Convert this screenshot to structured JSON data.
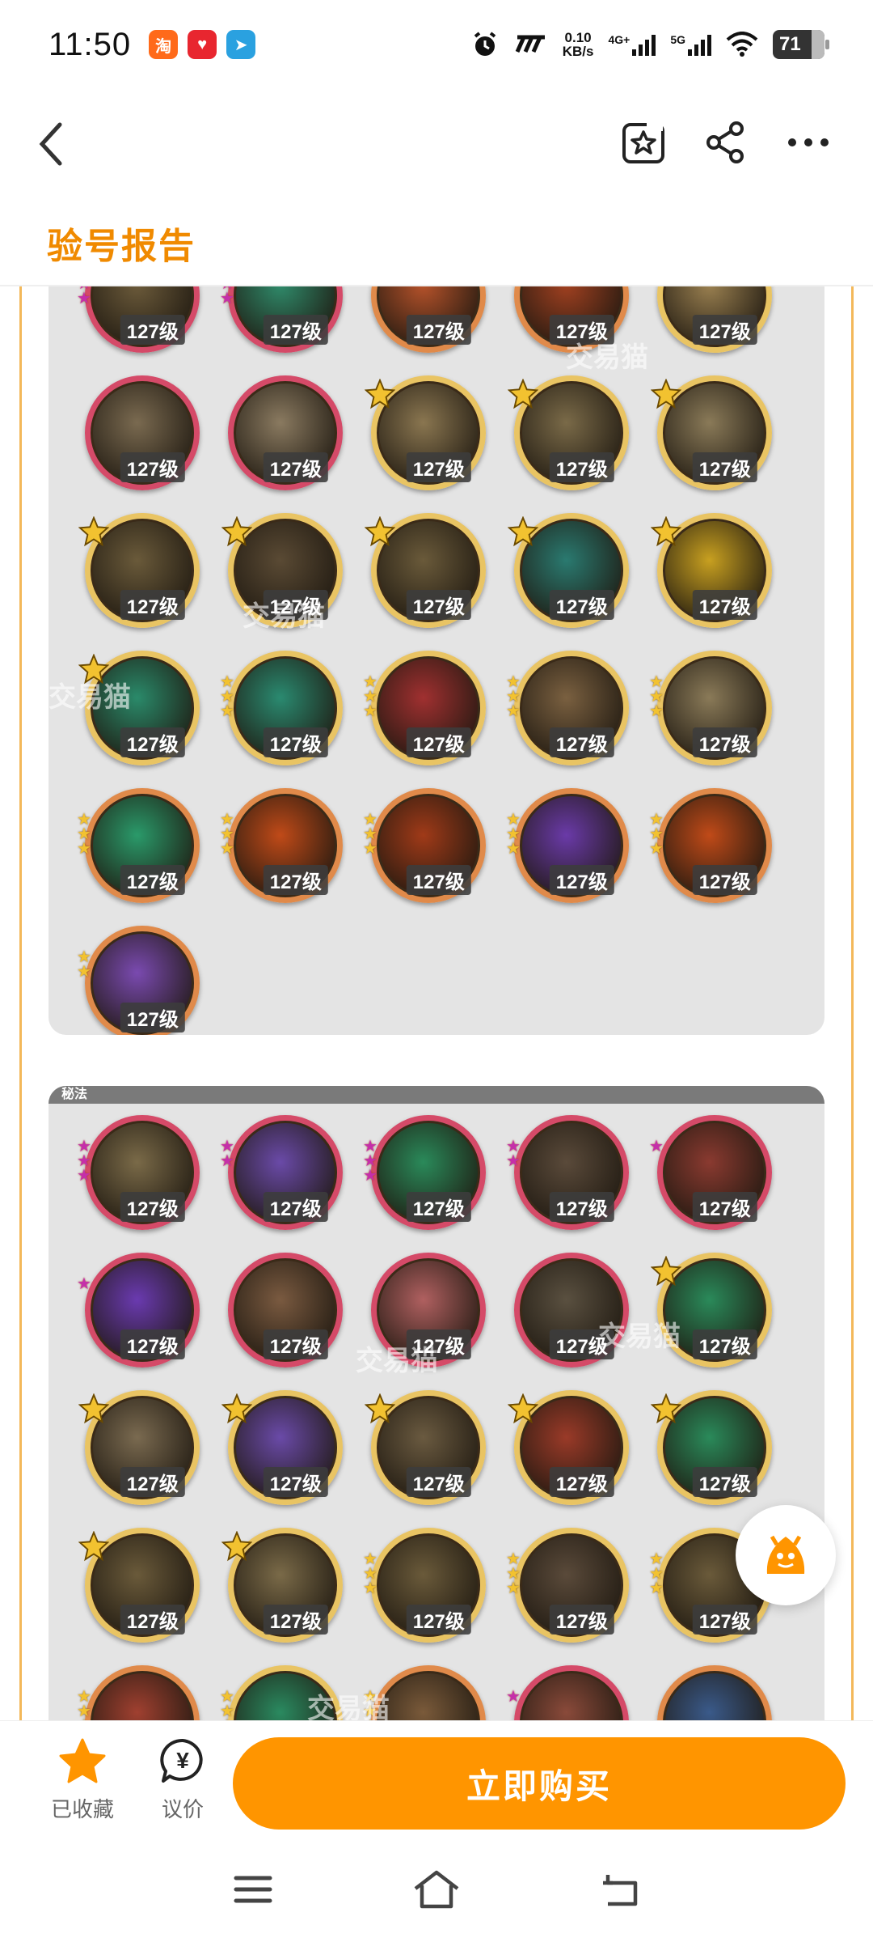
{
  "status_bar": {
    "time": "11:50",
    "net_speed_value": "0.10",
    "net_speed_unit": "KB/s",
    "signal1": "4G+",
    "signal2": "5G",
    "battery": "71",
    "apps": [
      {
        "name": "taobao-app-icon",
        "glyph": "淘",
        "color": "#ff6a1a"
      },
      {
        "name": "red-app-icon",
        "glyph": "♥",
        "color": "#e8262f"
      },
      {
        "name": "telegram-app-icon",
        "glyph": "➤",
        "color": "#2aa1e0"
      }
    ]
  },
  "header": {
    "title": "验号报告"
  },
  "panels": {
    "secret_label": "秘法"
  },
  "skill_level": "127级",
  "watermark": "交易猫",
  "bottom_bar": {
    "favorite_label": "已收藏",
    "bargain_label": "议价",
    "bargain_glyph": "¥",
    "buy_label": "立即购买"
  },
  "colors": {
    "accent": "#ff9500",
    "title": "#f08a00",
    "frame": "#f3b85a"
  },
  "skills_panel1": [
    {
      "ring": "red",
      "badge": "stars3",
      "art": "#6b5a3a"
    },
    {
      "ring": "red",
      "badge": "stars3",
      "art": "#2f8a6a"
    },
    {
      "ring": "orange",
      "badge": "none",
      "art": "#b5522a"
    },
    {
      "ring": "orange",
      "badge": "stars1",
      "art": "#a04020"
    },
    {
      "ring": "gold",
      "badge": "none",
      "art": "#9a8050"
    },
    {
      "ring": "red",
      "badge": "none",
      "art": "#7a6a50"
    },
    {
      "ring": "red",
      "badge": "none",
      "art": "#8a7a60"
    },
    {
      "ring": "gold",
      "badge": "five",
      "art": "#8a7650"
    },
    {
      "ring": "gold",
      "badge": "five",
      "art": "#7a6a48"
    },
    {
      "ring": "gold",
      "badge": "five",
      "art": "#8a7a58"
    },
    {
      "ring": "gold",
      "badge": "five",
      "art": "#6a5a3a"
    },
    {
      "ring": "gold",
      "badge": "five",
      "art": "#5a4a34"
    },
    {
      "ring": "gold",
      "badge": "five",
      "art": "#6a5a3a"
    },
    {
      "ring": "gold",
      "badge": "five",
      "art": "#2a7a70"
    },
    {
      "ring": "gold",
      "badge": "five",
      "art": "#c8a020"
    },
    {
      "ring": "gold",
      "badge": "five",
      "art": "#2a8a6a"
    },
    {
      "ring": "gold",
      "badge": "stars3",
      "art": "#2a8a70"
    },
    {
      "ring": "gold",
      "badge": "stars3",
      "art": "#a03030"
    },
    {
      "ring": "gold",
      "badge": "stars3",
      "art": "#7a6040"
    },
    {
      "ring": "gold",
      "badge": "stars3",
      "art": "#8a7a58"
    },
    {
      "ring": "orange",
      "badge": "stars3",
      "art": "#2a9a6a"
    },
    {
      "ring": "orange",
      "badge": "stars3",
      "art": "#c04a18"
    },
    {
      "ring": "orange",
      "badge": "stars3",
      "art": "#a03a18"
    },
    {
      "ring": "orange",
      "badge": "stars3",
      "art": "#6a3aa8"
    },
    {
      "ring": "orange",
      "badge": "stars3",
      "art": "#c04a18"
    },
    {
      "ring": "orange",
      "badge": "stars2",
      "art": "#7a4ab0"
    }
  ],
  "skills_panel2": [
    {
      "ring": "red",
      "badge": "stars3",
      "art": "#7a6a48"
    },
    {
      "ring": "red",
      "badge": "stars2",
      "art": "#6a4aa8"
    },
    {
      "ring": "red",
      "badge": "stars3",
      "art": "#2a8a5a"
    },
    {
      "ring": "red",
      "badge": "stars2",
      "art": "#5a4a3a"
    },
    {
      "ring": "red",
      "badge": "stars1",
      "art": "#8a3a30"
    },
    {
      "ring": "red",
      "badge": "stars1",
      "art": "#6a3ab0"
    },
    {
      "ring": "red",
      "badge": "none",
      "art": "#7a5a40"
    },
    {
      "ring": "red",
      "badge": "none",
      "art": "#b06060"
    },
    {
      "ring": "red",
      "badge": "none",
      "art": "#5a5040"
    },
    {
      "ring": "gold",
      "badge": "five",
      "art": "#2a8a5a"
    },
    {
      "ring": "gold",
      "badge": "five",
      "art": "#7a6a50"
    },
    {
      "ring": "gold",
      "badge": "five",
      "art": "#6a4aa8"
    },
    {
      "ring": "gold",
      "badge": "five",
      "art": "#6a5a40"
    },
    {
      "ring": "gold",
      "badge": "five",
      "art": "#9a3a28"
    },
    {
      "ring": "gold",
      "badge": "five",
      "art": "#2a8a5a"
    },
    {
      "ring": "gold",
      "badge": "five",
      "art": "#6a5a3a"
    },
    {
      "ring": "gold",
      "badge": "five",
      "art": "#7a6a48"
    },
    {
      "ring": "gold",
      "badge": "stars3",
      "art": "#6a5a3a"
    },
    {
      "ring": "gold",
      "badge": "stars3",
      "art": "#5a4a3a"
    },
    {
      "ring": "gold",
      "badge": "stars3",
      "art": "#6a5a3a"
    },
    {
      "ring": "orange",
      "badge": "stars3",
      "art": "#a04030"
    },
    {
      "ring": "gold",
      "badge": "stars3",
      "art": "#2a8a60"
    },
    {
      "ring": "orange",
      "badge": "stars3",
      "art": "#7a5a3a"
    },
    {
      "ring": "red",
      "badge": "stars1",
      "art": "#8a4a3a"
    },
    {
      "ring": "orange",
      "badge": "none",
      "art": "#3a5a8a"
    }
  ]
}
